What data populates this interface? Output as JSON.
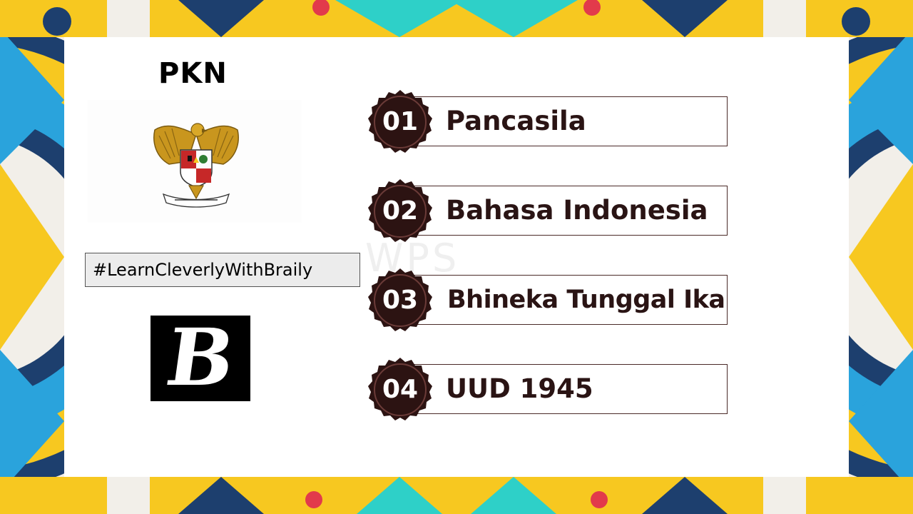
{
  "slide": {
    "subject": "PKN",
    "hashtag": "#LearnCleverlyWithBraily",
    "logo_letter": "B",
    "watermark": "WPS",
    "emblem_icon": "garuda-pancasila-emblem",
    "items": [
      {
        "number": "01",
        "label": "Pancasila"
      },
      {
        "number": "02",
        "label": "Bahasa Indonesia"
      },
      {
        "number": "03",
        "label": "Bhineka Tunggal Ika"
      },
      {
        "number": "04",
        "label": "UUD 1945"
      }
    ]
  },
  "colors": {
    "seal": "#2c1312",
    "label_text": "#2a1414",
    "bar_border": "#4a2a28",
    "background_yellow": "#f7c820",
    "background_blue": "#2aa3dc",
    "background_navy": "#1d3f6e",
    "background_teal": "#2ed0c8",
    "background_red": "#e23a4b"
  }
}
